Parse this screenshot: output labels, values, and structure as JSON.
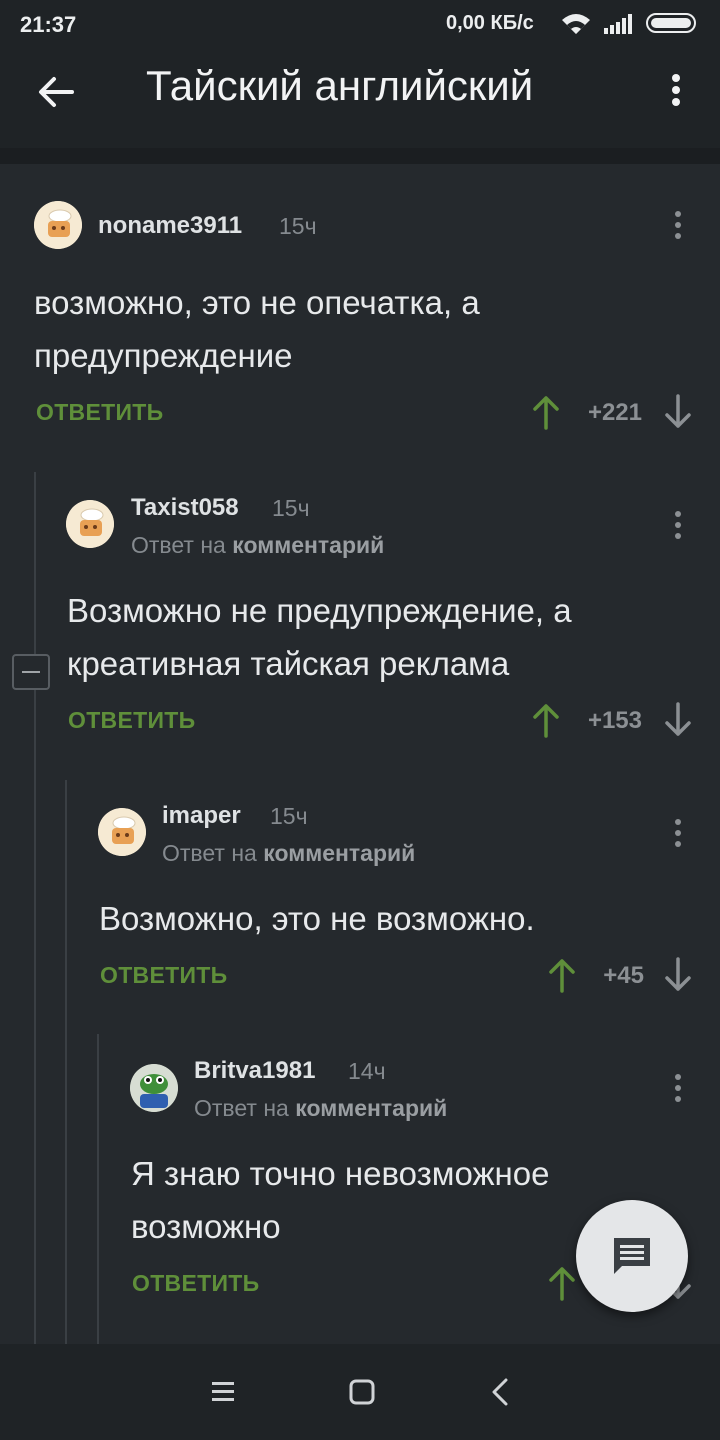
{
  "status_bar": {
    "time": "21:37",
    "network_speed": "0,00 КБ/с"
  },
  "app_bar": {
    "title": "Тайский английский"
  },
  "colors": {
    "background": "#25292d",
    "bar": "#1f2326",
    "reply_green": "#5f8f3a",
    "upvote_green": "#5f8f3a"
  },
  "comments": [
    {
      "username": "noname3911",
      "time": "15ч",
      "reply_to": null,
      "text_lines": [
        "возможно, это не опечатка, а",
        "предупреждение"
      ],
      "reply_label": "ОТВЕТИТЬ",
      "rating": "+221"
    },
    {
      "username": "Taxist058",
      "time": "15ч",
      "reply_to": {
        "prefix": "Ответ на",
        "target": "комментарий"
      },
      "text_lines": [
        "Возможно не предупреждение, а",
        "креативная тайская реклама"
      ],
      "reply_label": "ОТВЕТИТЬ",
      "rating": "+153"
    },
    {
      "username": "imaper",
      "time": "15ч",
      "reply_to": {
        "prefix": "Ответ на",
        "target": "комментарий"
      },
      "text_lines": [
        "Возможно, это не возможно."
      ],
      "reply_label": "ОТВЕТИТЬ",
      "rating": "+45"
    },
    {
      "username": "Britva1981",
      "time": "14ч",
      "reply_to": {
        "prefix": "Ответ на",
        "target": "комментарий"
      },
      "text_lines": [
        "Я знаю точно невозможное",
        "возможно"
      ],
      "reply_label": "ОТВЕТИТЬ",
      "rating": ""
    }
  ],
  "icons": {
    "back": "arrow-left-icon",
    "more": "more-vertical-icon",
    "upvote": "arrow-up-icon",
    "downvote": "arrow-down-icon",
    "collapse": "minus-box-icon",
    "fab": "chat-bubble-icon",
    "nav": [
      "menu-icon",
      "square-home-icon",
      "chevron-left-icon"
    ]
  }
}
